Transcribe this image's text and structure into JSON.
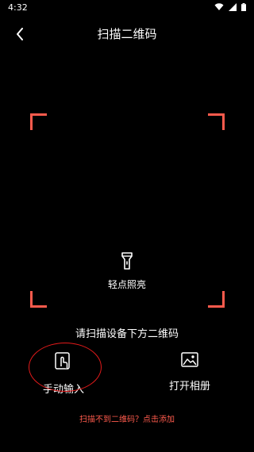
{
  "status_bar": {
    "time": "4:32",
    "icons": [
      "wifi-icon",
      "signal-icon",
      "battery-icon"
    ]
  },
  "header": {
    "title": "扫描二维码"
  },
  "flashlight": {
    "label": "轻点照亮",
    "icon": "flashlight-icon"
  },
  "scan_tip": "请扫描设备下方二维码",
  "actions": {
    "manual": {
      "label": "手动输入",
      "icon": "tap-icon"
    },
    "album": {
      "label": "打开相册",
      "icon": "image-icon"
    }
  },
  "footer": {
    "link": "扫描不到二维码？点击添加"
  },
  "colors": {
    "background": "#000000",
    "accent": "#ff5b4d",
    "ring": "#e41a1a"
  }
}
